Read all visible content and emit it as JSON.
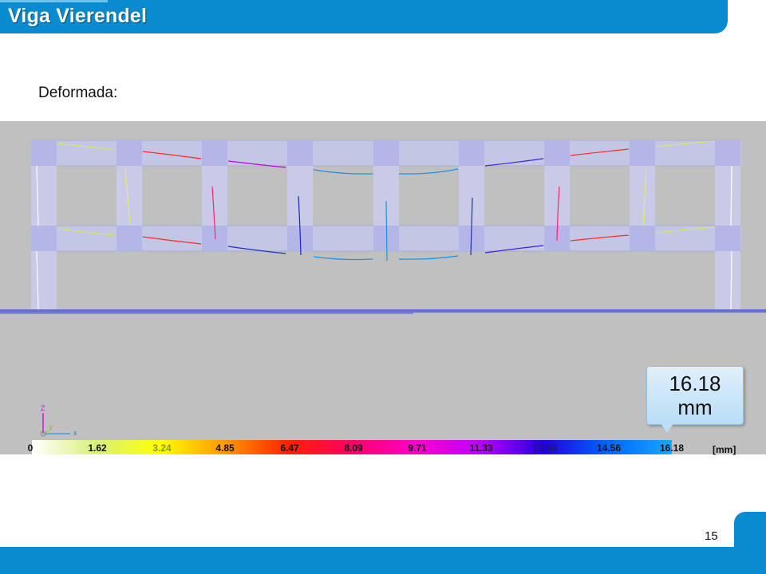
{
  "slide": {
    "title": "Viga Vierendel",
    "subtitle": "Deformada:",
    "page_number": "15"
  },
  "viewport": {
    "axes": {
      "z": "Z",
      "y": "y",
      "x": "x"
    },
    "colorbar": {
      "labels": [
        "0",
        "1.62",
        "3.24",
        "4.85",
        "6.47",
        "8.09",
        "9.71",
        "11.33",
        "12.94",
        "14.56",
        "16.18"
      ],
      "unit": "[mm]",
      "gradient_colors": [
        "#ffffff",
        "#d8f07a",
        "#ffff00",
        "#ff9900",
        "#ff2200",
        "#ff0066",
        "#ff00cc",
        "#bb00ff",
        "#2200dd",
        "#0066ff",
        "#1aa8ff"
      ]
    },
    "callout": {
      "value": "16.18",
      "unit": "mm"
    }
  }
}
